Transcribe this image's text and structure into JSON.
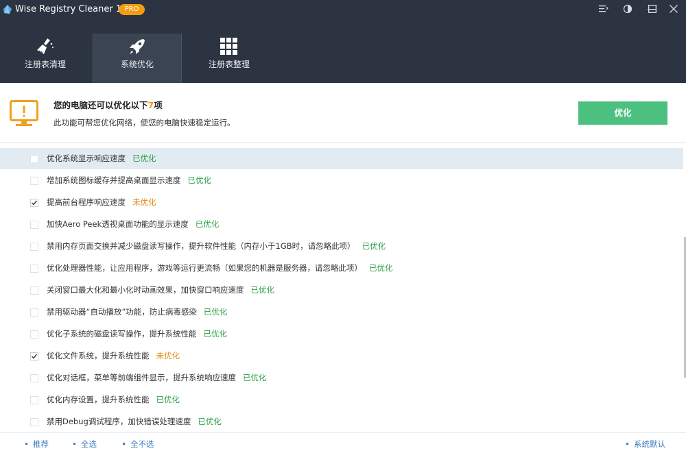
{
  "app": {
    "title": "Wise Registry Cleaner 11",
    "badge": "PRO"
  },
  "window_controls": [
    "menu-icon",
    "theme-icon",
    "minimize-icon",
    "maximize-icon",
    "close-icon"
  ],
  "nav": {
    "tabs": [
      {
        "label": "注册表清理",
        "icon": "broom-icon"
      },
      {
        "label": "系统优化",
        "icon": "rocket-icon",
        "active": true
      },
      {
        "label": "注册表整理",
        "icon": "grid-icon"
      }
    ]
  },
  "banner": {
    "title_prefix": "您的电脑还可以优化以下",
    "count": "7",
    "title_suffix": "项",
    "subtitle": "此功能可帮您优化网络，使您的电脑快速稳定运行。",
    "button_label": "优化"
  },
  "items": [
    {
      "label": "优化系统显示响应速度",
      "status": "已优化",
      "checked": false
    },
    {
      "label": "增加系统图标缓存并提高桌面显示速度",
      "status": "已优化",
      "checked": false
    },
    {
      "label": "提高前台程序响应速度",
      "status": "未优化",
      "checked": true
    },
    {
      "label": "加快Aero Peek透视桌面功能的显示速度",
      "status": "已优化",
      "checked": false
    },
    {
      "label": "禁用内存页面交换并减少磁盘读写操作，提升软件性能（内存小于1GB时，请忽略此项）",
      "status": "已优化",
      "checked": false
    },
    {
      "label": "优化处理器性能，让应用程序，游戏等运行更流畅（如果您的机器是服务器，请忽略此项）",
      "status": "已优化",
      "checked": false
    },
    {
      "label": "关闭窗口最大化和最小化时动画效果，加快窗口响应速度",
      "status": "已优化",
      "checked": false
    },
    {
      "label": "禁用驱动器“自动播放”功能，防止病毒感染",
      "status": "已优化",
      "checked": false
    },
    {
      "label": "优化子系统的磁盘读写操作，提升系统性能",
      "status": "已优化",
      "checked": false
    },
    {
      "label": "优化文件系统，提升系统性能",
      "status": "未优化",
      "checked": true
    },
    {
      "label": "优化对话框，菜单等前端组件显示，提升系统响应速度",
      "status": "已优化",
      "checked": false
    },
    {
      "label": "优化内存设置，提升系统性能",
      "status": "已优化",
      "checked": false
    },
    {
      "label": "禁用Debug调试程序，加快错误处理速度",
      "status": "已优化",
      "checked": false
    }
  ],
  "footer": {
    "recommend": "推荐",
    "select_all": "全选",
    "select_none": "全不选",
    "system_default": "系统默认"
  },
  "colors": {
    "header_bg": "#2c3441",
    "accent_green": "#4cc17f",
    "done": "#2e9e46",
    "todo": "#e08b12",
    "link": "#3a7ac0",
    "badge": "#f39c12"
  }
}
